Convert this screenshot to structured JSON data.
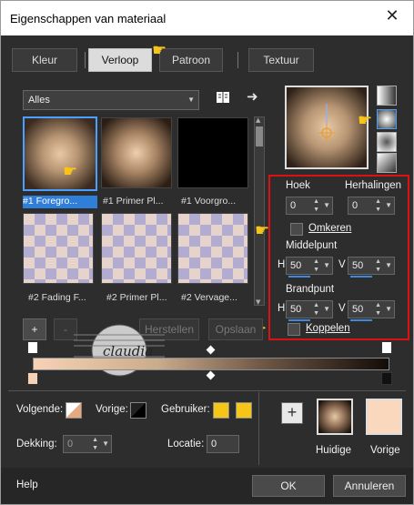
{
  "window": {
    "title": "Eigenschappen van materiaal"
  },
  "tabs": [
    {
      "label": "Kleur",
      "active": false
    },
    {
      "label": "Verloop",
      "active": true
    },
    {
      "label": "Patroon",
      "active": false
    },
    {
      "label": "Textuur",
      "active": false
    }
  ],
  "category_select": {
    "value": "Alles"
  },
  "gallery": {
    "items": [
      {
        "label": "#1 Foregro...",
        "style": "rect",
        "selected": true
      },
      {
        "label": "#1 Primer Pl...",
        "style": "rect2",
        "selected": false
      },
      {
        "label": "#1 Voorgro...",
        "style": "black",
        "selected": false
      },
      {
        "label": "#2 Fading F...",
        "style": "checker",
        "selected": false
      },
      {
        "label": "#2 Primer Pl...",
        "style": "checker",
        "selected": false
      },
      {
        "label": "#2 Vervage...",
        "style": "checker",
        "selected": false
      }
    ]
  },
  "params": {
    "angle_label": "Hoek",
    "angle_value": "0",
    "repeats_label": "Herhalingen",
    "repeats_value": "0",
    "invert_label": "Omkeren",
    "center_label": "Middelpunt",
    "center_h": "50",
    "center_v": "50",
    "focal_label": "Brandpunt",
    "focal_h": "50",
    "focal_v": "50",
    "link_label": "Koppelen",
    "h_label": "H",
    "v_label": "V"
  },
  "editor": {
    "add_label": "+",
    "remove_label": "-",
    "restore_label": "Herstellen",
    "save_label": "Opslaan"
  },
  "watermark_text": "claudia",
  "bottom": {
    "next_label": "Volgende:",
    "prev_label": "Vorige:",
    "user_label": "Gebruiker:",
    "opacity_label": "Dekking:",
    "opacity_value": "0",
    "location_label": "Locatie:",
    "location_value": "0",
    "current_label": "Huidige",
    "previous_label": "Vorige",
    "user_color_1": "#f5c518",
    "user_color_2": "#f5c518",
    "previous_color": "#f9d8bd"
  },
  "footer": {
    "help_label": "Help",
    "ok_label": "OK",
    "cancel_label": "Annuleren"
  }
}
